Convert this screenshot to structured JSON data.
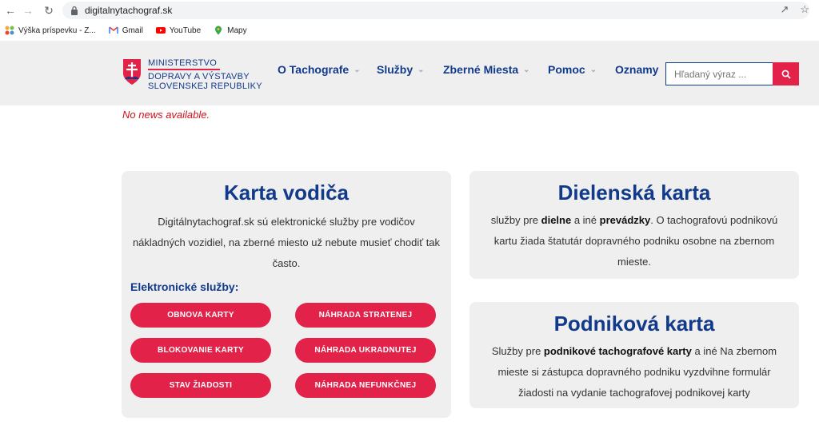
{
  "browser": {
    "url": "digitalnytachograf.sk",
    "bookmarks": [
      {
        "label": "Výška príspevku - Z...",
        "icon": "joomla-icon"
      },
      {
        "label": "Gmail",
        "icon": "gmail-icon"
      },
      {
        "label": "YouTube",
        "icon": "youtube-icon"
      },
      {
        "label": "Mapy",
        "icon": "maps-pin-icon"
      }
    ]
  },
  "header": {
    "logo_line1": "MINISTERSTVO",
    "logo_line2": "DOPRAVY A VÝSTAVBY",
    "logo_line3": "SLOVENSKEJ REPUBLIKY",
    "nav": [
      {
        "label": "O Tachografe",
        "has_caret": true
      },
      {
        "label": "Služby",
        "has_caret": true
      },
      {
        "label": "Zberné Miesta",
        "has_caret": true
      },
      {
        "label": "Pomoc",
        "has_caret": true
      },
      {
        "label": "Oznamy",
        "has_caret": false
      }
    ],
    "search_placeholder": "Hľadaný výraz ..."
  },
  "notice": "No news available.",
  "cards": {
    "driver": {
      "title": "Karta vodiča",
      "text": "Digitálnytachograf.sk sú elektronické služby pre vodičov nákladných vozidiel, na zberné miesto už nebute musieť chodiť tak často.",
      "services_label": "Elektronické služby:",
      "buttons": [
        "OBNOVA KARTY",
        "NÁHRADA STRATENEJ",
        "BLOKOVANIE KARTY",
        "NÁHRADA UKRADNUTEJ",
        "STAV ŽIADOSTI",
        "NÁHRADA NEFUNKČNEJ"
      ]
    },
    "workshop": {
      "title": "Dielenská karta",
      "text_1": "služby pre ",
      "bold_1": "dielne",
      "text_2": " a iné ",
      "bold_2": "prevádzky",
      "text_3": ". O tachografovú podnikovú kartu žiada štatutár dopravného podniku osobne na zbernom mieste."
    },
    "company": {
      "title": "Podniková karta",
      "text_1": "Služby pre ",
      "bold_1": "podnikové tachografové karty",
      "text_2": " a iné Na zbernom mieste si zástupca dopravného podniku vyzdvihne formulár žiadosti na vydanie tachografovej podnikovej karty"
    }
  },
  "colors": {
    "brand_blue": "#123a8a",
    "accent_red": "#e32249",
    "card_bg": "#efefef"
  }
}
